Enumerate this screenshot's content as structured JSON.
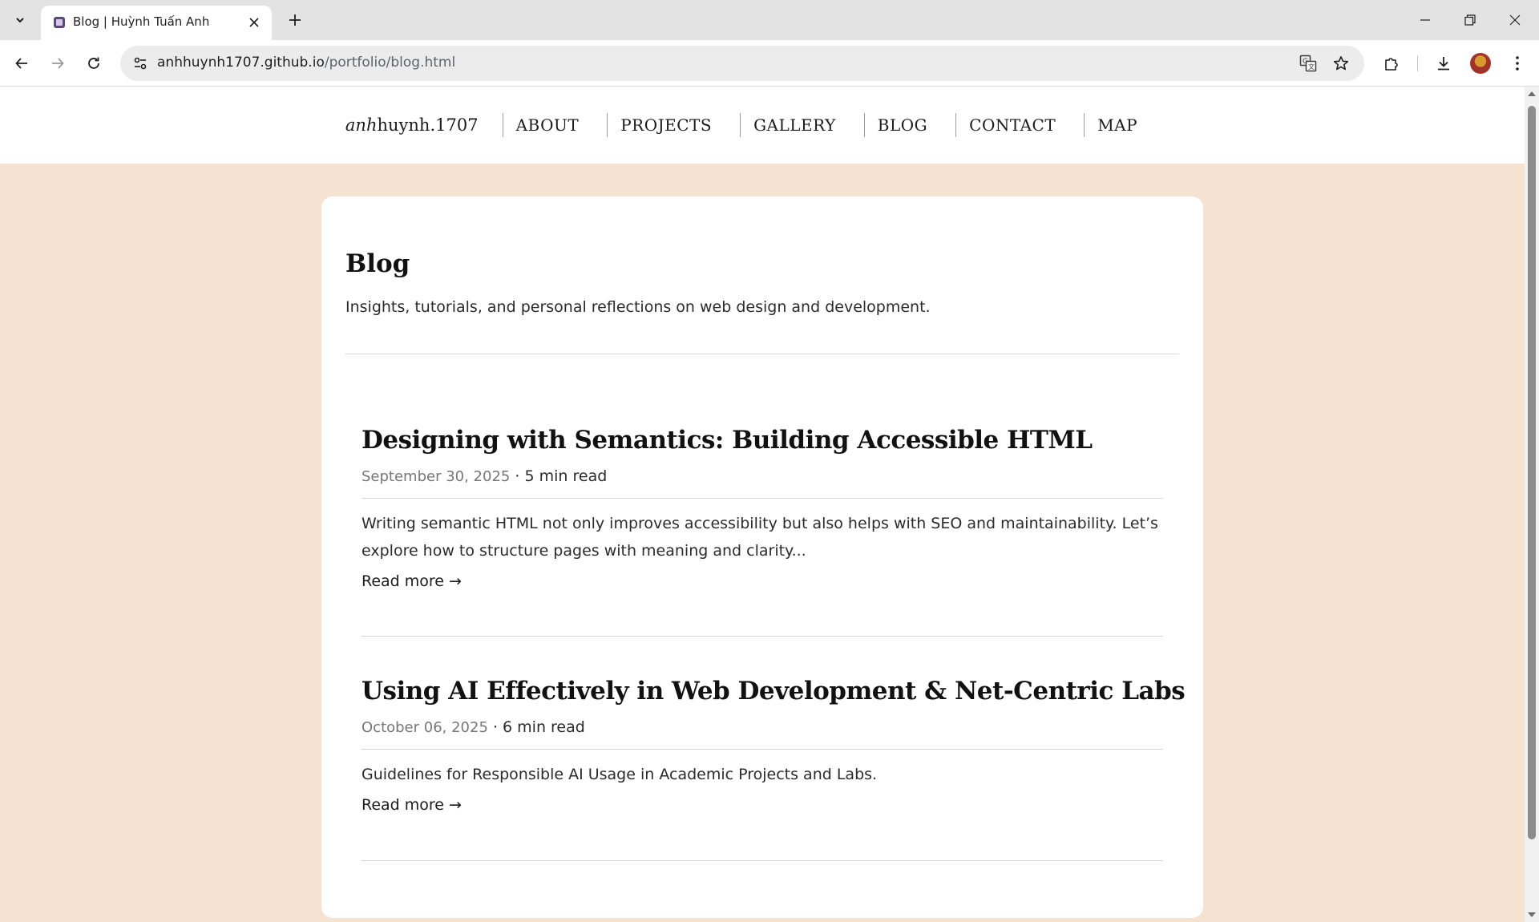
{
  "browser": {
    "tab_title": "Blog | Huỳnh Tuấn Anh",
    "url_host": "anhhuynh1707.github.io",
    "url_path": "/portfolio/blog.html"
  },
  "site": {
    "brand_italic": "anh",
    "brand_rest": "huynh.1707",
    "nav": [
      {
        "label": "ABOUT"
      },
      {
        "label": "PROJECTS"
      },
      {
        "label": "GALLERY"
      },
      {
        "label": "BLOG"
      },
      {
        "label": "CONTACT"
      },
      {
        "label": "MAP"
      }
    ]
  },
  "blog": {
    "title": "Blog",
    "subtitle": "Insights, tutorials, and personal reflections on web design and development.",
    "posts": [
      {
        "title": "Designing with Semantics: Building Accessible HTML",
        "date": "September 30, 2025",
        "read_time": " · 5 min read",
        "excerpt": "Writing semantic HTML not only improves accessibility but also helps with SEO and maintainability. Let’s explore how to structure pages with meaning and clarity...",
        "read_more": "Read more →"
      },
      {
        "title": "Using AI Effectively in Web Development & Net-Centric Labs",
        "date": "October 06, 2025",
        "read_time": " · 6 min read",
        "excerpt": "Guidelines for Responsible AI Usage in Academic Projects and Labs.",
        "read_more": "Read more →"
      }
    ]
  },
  "colors": {
    "page_bg": "#f5e2d1",
    "card_bg": "#ffffff",
    "text": "#1b1b1b"
  }
}
